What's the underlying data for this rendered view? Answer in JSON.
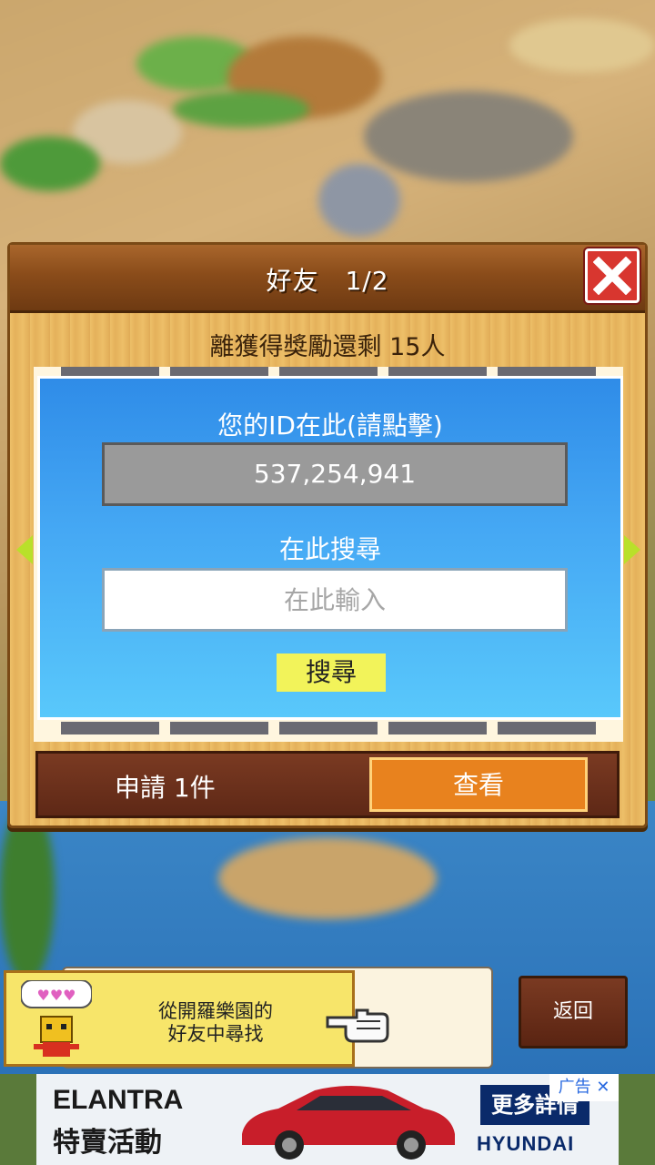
{
  "dialog": {
    "title": "好友　1/2",
    "subtitle": "離獲得獎勵還剩 15人",
    "id_label": "您的ID在此(請點擊)",
    "id_value": "537,254,941",
    "search_label": "在此搜尋",
    "search_placeholder": "在此輸入",
    "search_button": "搜尋",
    "requests_label": "申請 1件",
    "view_button": "查看"
  },
  "hint": {
    "line1": "從開羅樂園的",
    "line2": "好友中尋找"
  },
  "back_button": "返回",
  "ad": {
    "brand": "ELANTRA",
    "promo": "特賣活動",
    "more_button": "更多詳情",
    "ad_tag": "广告 ✕",
    "logo_text": "HYUNDAI"
  },
  "colors": {
    "panel_blue": "#45a8f4",
    "close_red": "#d8362f",
    "search_yellow": "#f2f35a",
    "view_orange": "#e8821e"
  }
}
